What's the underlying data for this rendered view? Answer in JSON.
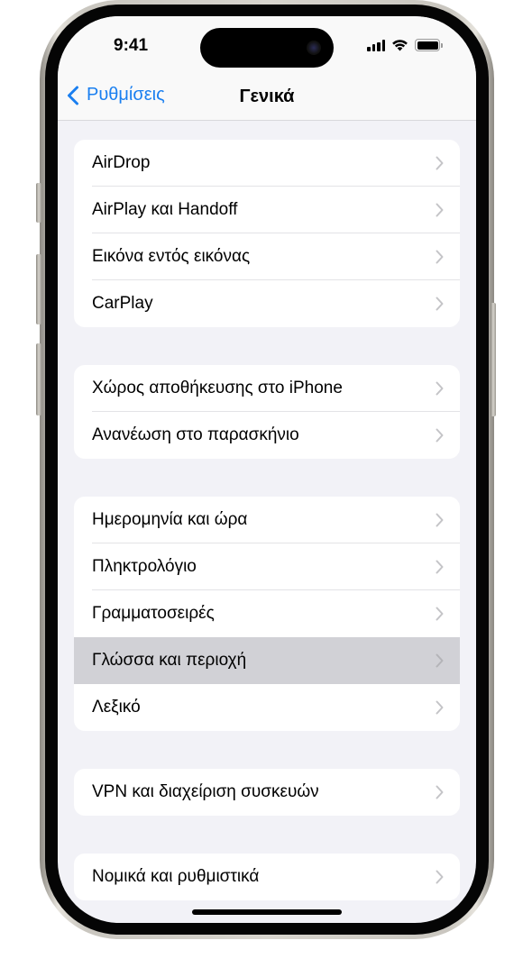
{
  "status_bar": {
    "time": "9:41",
    "icons": [
      "cellular-signal-icon",
      "wifi-icon",
      "battery-icon"
    ]
  },
  "nav": {
    "back_label": "Ρυθμίσεις",
    "title": "Γενικά",
    "accent_color": "#1a7ff0"
  },
  "groups": [
    {
      "items": [
        {
          "label": "AirDrop"
        },
        {
          "label": "AirPlay και Handoff"
        },
        {
          "label": "Εικόνα εντός εικόνας"
        },
        {
          "label": "CarPlay"
        }
      ]
    },
    {
      "items": [
        {
          "label": "Χώρος αποθήκευσης στο iPhone"
        },
        {
          "label": "Ανανέωση στο παρασκήνιο"
        }
      ]
    },
    {
      "items": [
        {
          "label": "Ημερομηνία και ώρα"
        },
        {
          "label": "Πληκτρολόγιο"
        },
        {
          "label": "Γραμματοσειρές"
        },
        {
          "label": "Γλώσσα και περιοχή",
          "highlighted": true
        },
        {
          "label": "Λεξικό"
        }
      ]
    },
    {
      "items": [
        {
          "label": "VPN και διαχείριση συσκευών"
        }
      ]
    },
    {
      "items": [
        {
          "label": "Νομικά και ρυθμιστικά"
        }
      ]
    }
  ]
}
